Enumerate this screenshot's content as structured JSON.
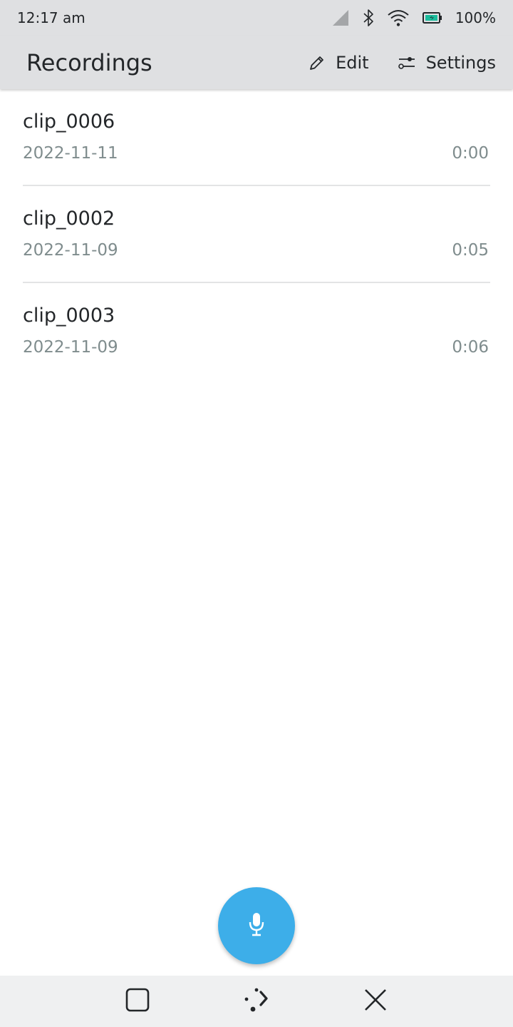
{
  "status_bar": {
    "time": "12:17 am",
    "battery_percent": "100%",
    "icons": [
      "signal-icon",
      "bluetooth-icon",
      "wifi-icon",
      "battery-icon"
    ]
  },
  "header": {
    "title": "Recordings",
    "edit_label": "Edit",
    "settings_label": "Settings"
  },
  "recordings": [
    {
      "name": "clip_0006",
      "date": "2022-11-11",
      "duration": "0:00"
    },
    {
      "name": "clip_0002",
      "date": "2022-11-09",
      "duration": "0:05"
    },
    {
      "name": "clip_0003",
      "date": "2022-11-09",
      "duration": "0:06"
    }
  ],
  "fab": {
    "icon": "microphone-icon"
  },
  "nav_bar": {
    "icons": [
      "overview-icon",
      "home-icon",
      "close-icon"
    ]
  },
  "colors": {
    "accent": "#3daee9",
    "header_bg": "#dfe0e2",
    "text": "#232629",
    "secondary_text": "#7f8c8d",
    "battery": "#1abc9c"
  }
}
